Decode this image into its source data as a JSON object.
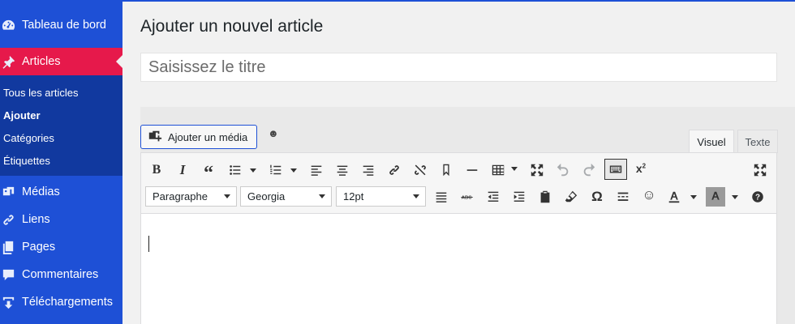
{
  "sidebar": {
    "items": [
      {
        "label": "Tableau de bord",
        "icon": "dashboard-icon"
      },
      {
        "label": "Articles",
        "icon": "pin-icon",
        "active": true
      },
      {
        "label": "Médias",
        "icon": "media-icon"
      },
      {
        "label": "Liens",
        "icon": "link-icon"
      },
      {
        "label": "Pages",
        "icon": "pages-icon"
      },
      {
        "label": "Commentaires",
        "icon": "comment-icon"
      },
      {
        "label": "Téléchargements",
        "icon": "download-icon"
      }
    ],
    "submenu": [
      "Tous les articles",
      "Ajouter",
      "Catégories",
      "Étiquettes"
    ],
    "current_submenu": "Ajouter"
  },
  "main": {
    "page_title": "Ajouter un nouvel article",
    "title_placeholder": "Saisissez le titre",
    "media_button": "Ajouter un média",
    "tabs": [
      "Visuel",
      "Texte"
    ],
    "active_tab": "Visuel"
  },
  "toolbar": {
    "format_select": "Paragraphe",
    "font_select": "Georgia",
    "size_select": "12pt",
    "special_char": "Ω"
  },
  "colors": {
    "sidebar": "#1e50d6",
    "active": "#e6194b",
    "submenu": "#11399f"
  }
}
